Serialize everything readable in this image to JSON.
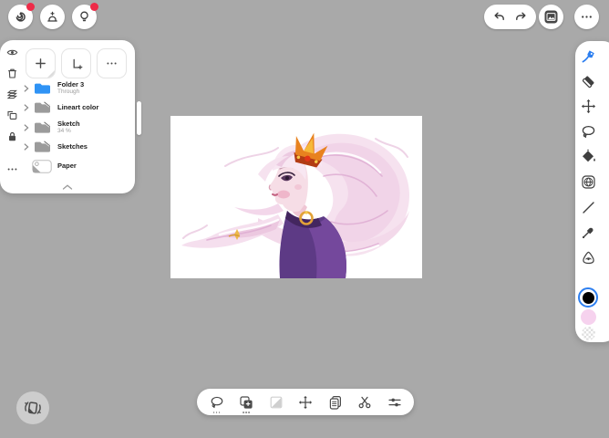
{
  "app": {
    "name": "digital-painting-app",
    "colors": {
      "background": "#a9a9a9",
      "panel": "#ffffff",
      "accent_blue": "#2d7ff0",
      "folder_blue": "#2f93f5",
      "badge_red": "#ee2b48",
      "icon_gray": "#434343",
      "disabled_icon": "#cfcfcf",
      "swatch_primary": "#000000",
      "swatch_secondary": "#f6d2ee"
    }
  },
  "top_left": {
    "buttons": [
      {
        "icon": "gallery-spiral-icon",
        "badge": true
      },
      {
        "icon": "layer-stack-add-icon",
        "badge": false
      },
      {
        "icon": "lightbulb-tips-icon",
        "badge": true
      }
    ]
  },
  "top_right": {
    "icons": [
      "undo-icon",
      "redo-icon",
      "image-export-icon",
      "more-ellipsis-icon"
    ]
  },
  "layers_panel": {
    "side_tools": [
      "visibility-eye",
      "delete-trash",
      "merge-layers",
      "duplicate-layer",
      "lock",
      "more-options"
    ],
    "header_buttons": [
      "add-layer",
      "new-group",
      "more-options"
    ],
    "layers": [
      {
        "name": "Folder 3",
        "subtitle": "Through",
        "type": "folder-blue",
        "expandable": true
      },
      {
        "name": "Lineart color",
        "subtitle": "",
        "type": "folder-hidden",
        "expandable": true
      },
      {
        "name": "Sketch",
        "subtitle": "34 %",
        "type": "folder-hidden",
        "expandable": true
      },
      {
        "name": "Sketches",
        "subtitle": "",
        "type": "folder-hidden",
        "expandable": true
      },
      {
        "name": "Paper",
        "subtitle": "",
        "type": "paper",
        "expandable": false
      }
    ],
    "collapse_icon": "chevron-up-icon"
  },
  "canvas": {
    "artwork_description": "Digital painting of a woman in left profile with long flowing pink-white hair, gold flame crown, gold hoop earring and purple garment on white background"
  },
  "right_toolbar": {
    "tools": [
      {
        "name": "paint-brush",
        "selected": true
      },
      {
        "name": "eraser",
        "selected": false
      },
      {
        "name": "move-transform",
        "selected": false
      },
      {
        "name": "lasso-select",
        "selected": false
      },
      {
        "name": "fill-bucket",
        "selected": false
      },
      {
        "name": "guides-grid",
        "selected": false
      },
      {
        "name": "line-tool",
        "selected": false
      },
      {
        "name": "eyedropper",
        "selected": false
      },
      {
        "name": "filter-fx",
        "selected": false
      }
    ],
    "swatches": [
      {
        "name": "primary-color",
        "color": "#000000",
        "selected": true
      },
      {
        "name": "secondary-color",
        "color": "#f6d2ee",
        "selected": false
      },
      {
        "name": "transparent-color",
        "color": "checkerboard",
        "selected": false
      }
    ]
  },
  "bottom_toolbar": {
    "tools": [
      {
        "name": "lasso-select",
        "has_options": true,
        "disabled": false
      },
      {
        "name": "copy-merged",
        "has_options": true,
        "disabled": false
      },
      {
        "name": "gradient-mask",
        "has_options": false,
        "disabled": true
      },
      {
        "name": "move",
        "has_options": false,
        "disabled": false
      },
      {
        "name": "paste-clipboard",
        "has_options": false,
        "disabled": false
      },
      {
        "name": "cut-scissors",
        "has_options": false,
        "disabled": false
      },
      {
        "name": "adjust-sliders",
        "has_options": false,
        "disabled": false
      }
    ]
  },
  "bottom_left": {
    "button": "rotate-canvas"
  }
}
